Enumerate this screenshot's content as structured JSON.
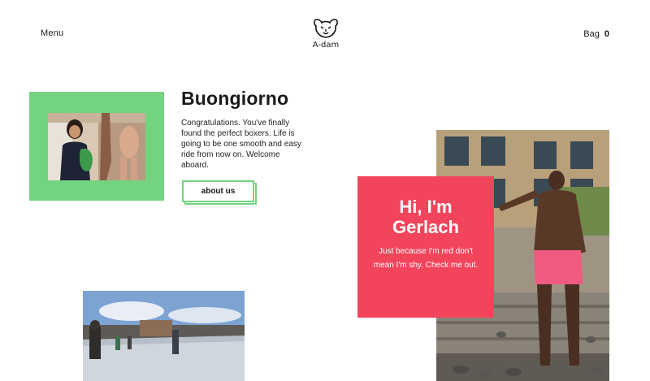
{
  "header": {
    "menu_label": "Menu",
    "logo_text": "A-dam",
    "bag_label": "Bag",
    "bag_count": "0"
  },
  "intro": {
    "headline": "Buongiorno",
    "text": "Congratulations. You've finally found the perfect boxers. Life is going to be one smooth and easy ride from now on. Welcome aboard.",
    "button_label": "about us"
  },
  "feature": {
    "title_line1": "Hi, I'm",
    "title_line2": "Gerlach",
    "text": "Just because I'm red don't mean I'm shy. Check me out."
  },
  "colors": {
    "green": "#73d47f",
    "red": "#f2455c",
    "text": "#1a1a1a"
  },
  "icons": {
    "logo": "lion-head-icon"
  }
}
